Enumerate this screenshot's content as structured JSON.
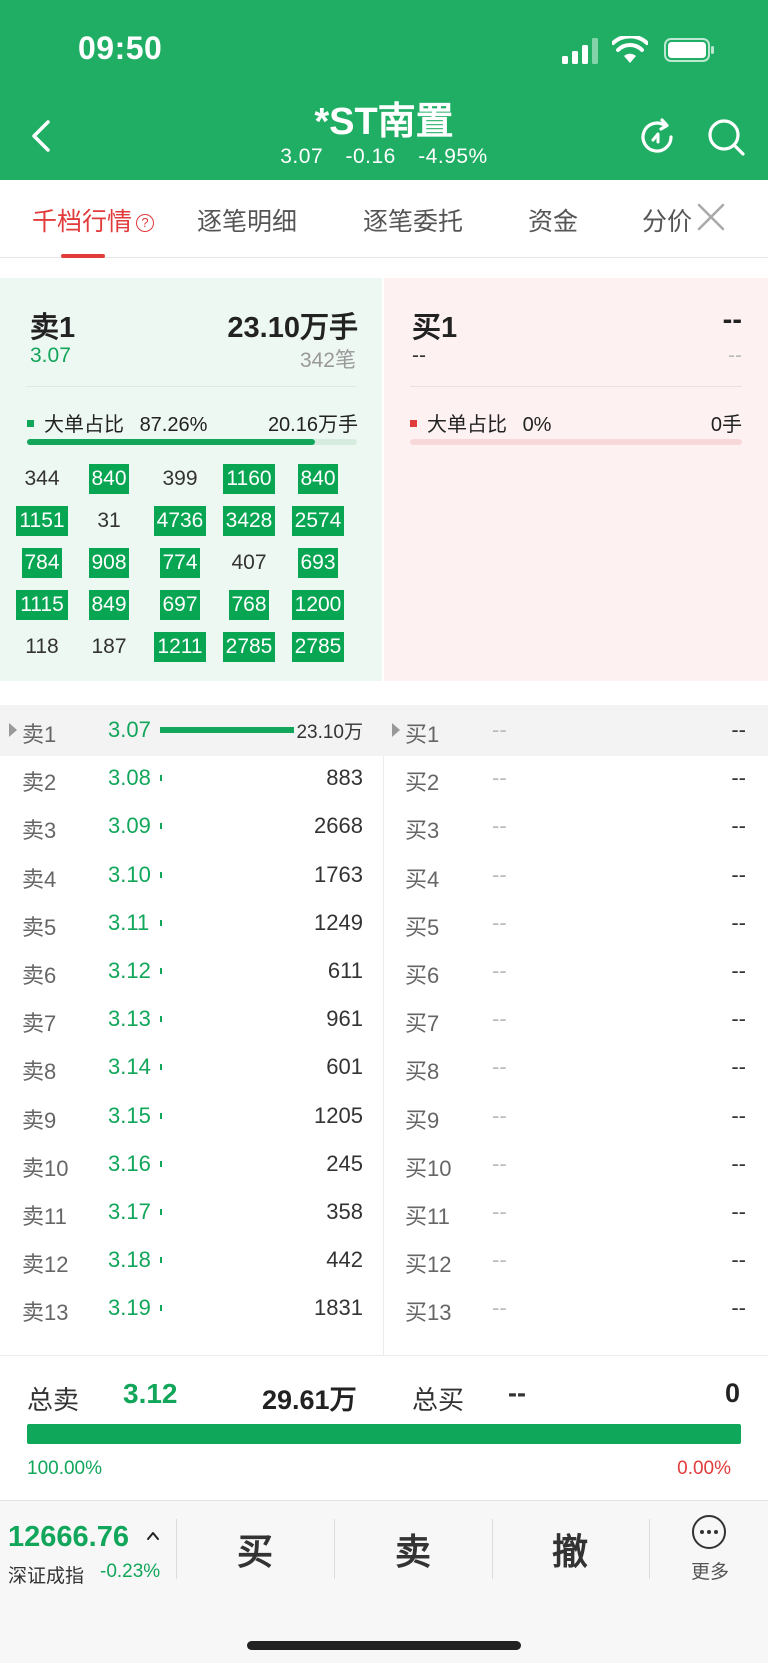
{
  "status_bar": {
    "time": "09:50"
  },
  "header": {
    "title": "*ST南置",
    "price": "3.07",
    "change": "-0.16",
    "change_pct": "-4.95%"
  },
  "tabs": [
    {
      "label": "千档行情",
      "active": true
    },
    {
      "label": "逐笔明细",
      "active": false
    },
    {
      "label": "逐笔委托",
      "active": false
    },
    {
      "label": "资金",
      "active": false
    },
    {
      "label": "分价",
      "active": false
    }
  ],
  "tab_help_symbol": "?",
  "sell_panel": {
    "label": "卖1",
    "volume": "23.10万手",
    "price": "3.07",
    "count": "342笔",
    "big_order_label": "大单占比",
    "big_order_pct": "87.26%",
    "big_order_volume": "20.16万手",
    "big_order_ratio": 0.8726
  },
  "buy_panel": {
    "label": "买1",
    "volume": "--",
    "price": "--",
    "count": "--",
    "big_order_label": "大单占比",
    "big_order_pct": "0%",
    "big_order_volume": "0手",
    "big_order_ratio": 0
  },
  "order_grid": [
    [
      {
        "v": "344",
        "hl": false
      },
      {
        "v": "840",
        "hl": true
      },
      {
        "v": "399",
        "hl": false
      },
      {
        "v": "1160",
        "hl": true
      },
      {
        "v": "840",
        "hl": true
      }
    ],
    [
      {
        "v": "1151",
        "hl": true
      },
      {
        "v": "31",
        "hl": false
      },
      {
        "v": "4736",
        "hl": true
      },
      {
        "v": "3428",
        "hl": true
      },
      {
        "v": "2574",
        "hl": true
      }
    ],
    [
      {
        "v": "784",
        "hl": true
      },
      {
        "v": "908",
        "hl": true
      },
      {
        "v": "774",
        "hl": true
      },
      {
        "v": "407",
        "hl": false
      },
      {
        "v": "693",
        "hl": true
      }
    ],
    [
      {
        "v": "1115",
        "hl": true
      },
      {
        "v": "849",
        "hl": true
      },
      {
        "v": "697",
        "hl": true
      },
      {
        "v": "768",
        "hl": true
      },
      {
        "v": "1200",
        "hl": true
      }
    ],
    [
      {
        "v": "118",
        "hl": false
      },
      {
        "v": "187",
        "hl": false
      },
      {
        "v": "1211",
        "hl": true
      },
      {
        "v": "2785",
        "hl": true
      },
      {
        "v": "2785",
        "hl": true
      }
    ]
  ],
  "sell_book": [
    {
      "label": "卖1",
      "price": "3.07",
      "volume": "23.10万"
    },
    {
      "label": "卖2",
      "price": "3.08",
      "volume": "883"
    },
    {
      "label": "卖3",
      "price": "3.09",
      "volume": "2668"
    },
    {
      "label": "卖4",
      "price": "3.10",
      "volume": "1763"
    },
    {
      "label": "卖5",
      "price": "3.11",
      "volume": "1249"
    },
    {
      "label": "卖6",
      "price": "3.12",
      "volume": "611"
    },
    {
      "label": "卖7",
      "price": "3.13",
      "volume": "961"
    },
    {
      "label": "卖8",
      "price": "3.14",
      "volume": "601"
    },
    {
      "label": "卖9",
      "price": "3.15",
      "volume": "1205"
    },
    {
      "label": "卖10",
      "price": "3.16",
      "volume": "245"
    },
    {
      "label": "卖11",
      "price": "3.17",
      "volume": "358"
    },
    {
      "label": "卖12",
      "price": "3.18",
      "volume": "442"
    },
    {
      "label": "卖13",
      "price": "3.19",
      "volume": "1831"
    }
  ],
  "buy_book": [
    {
      "label": "买1",
      "price": "--",
      "volume": "--"
    },
    {
      "label": "买2",
      "price": "--",
      "volume": "--"
    },
    {
      "label": "买3",
      "price": "--",
      "volume": "--"
    },
    {
      "label": "买4",
      "price": "--",
      "volume": "--"
    },
    {
      "label": "买5",
      "price": "--",
      "volume": "--"
    },
    {
      "label": "买6",
      "price": "--",
      "volume": "--"
    },
    {
      "label": "买7",
      "price": "--",
      "volume": "--"
    },
    {
      "label": "买8",
      "price": "--",
      "volume": "--"
    },
    {
      "label": "买9",
      "price": "--",
      "volume": "--"
    },
    {
      "label": "买10",
      "price": "--",
      "volume": "--"
    },
    {
      "label": "买11",
      "price": "--",
      "volume": "--"
    },
    {
      "label": "买12",
      "price": "--",
      "volume": "--"
    },
    {
      "label": "买13",
      "price": "--",
      "volume": "--"
    }
  ],
  "sell_bar_full_volume_ratio": 1.0,
  "summary": {
    "sell_label": "总卖",
    "sell_avg_price": "3.12",
    "sell_volume": "29.61万",
    "buy_label": "总买",
    "buy_avg_price": "--",
    "buy_volume": "0",
    "sell_pct": "100.00%",
    "buy_pct": "0.00%",
    "sell_ratio": 1.0
  },
  "bottom_bar": {
    "index_value": "12666.76",
    "index_name": "深证成指",
    "index_change": "-0.23%",
    "buy_label": "买",
    "sell_label": "卖",
    "cancel_label": "撤",
    "more_label": "更多"
  },
  "colors": {
    "header_green": "#1fae63",
    "rise_red": "#e23b3b",
    "fall_green": "#12a65a"
  }
}
